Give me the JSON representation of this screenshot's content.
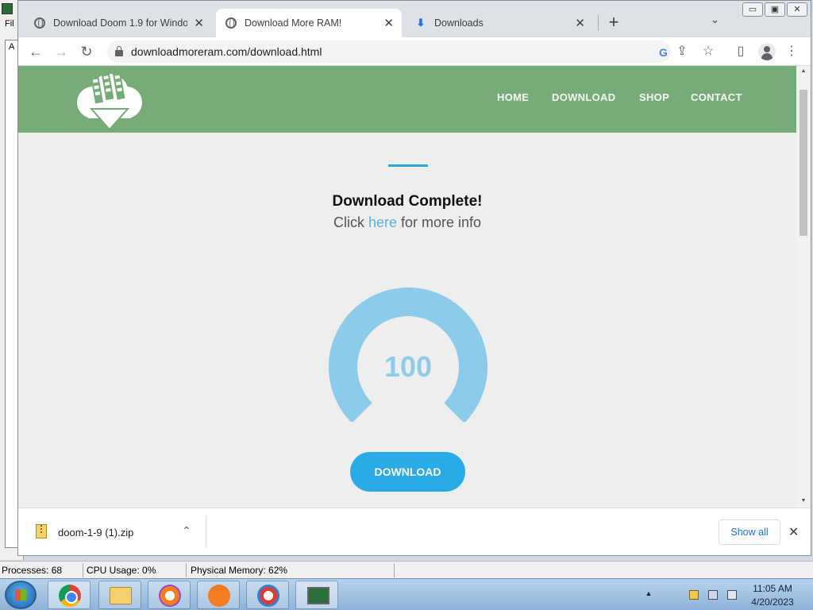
{
  "background_app": {
    "menu_label": "Fil",
    "box_label": "A"
  },
  "browser": {
    "tabs": [
      {
        "title": "Download Doom 1.9 for Window",
        "active": false
      },
      {
        "title": "Download More RAM!",
        "active": true
      },
      {
        "title": "Downloads",
        "active": false
      }
    ],
    "tab_close_glyph": "✕",
    "new_tab_glyph": "+",
    "tab_search_glyph": "⌄",
    "window_controls": [
      "▭",
      "▣",
      "✕"
    ],
    "nav": {
      "back": "←",
      "forward": "→",
      "reload": "↻"
    },
    "url": "downloadmoreram.com/download.html",
    "icons": {
      "google": "G",
      "share": "⇪",
      "bookmark": "☆",
      "sidebar": "▯",
      "menu": "⋮"
    }
  },
  "site": {
    "nav_links": [
      "HOME",
      "DOWNLOAD",
      "SHOP",
      "CONTACT"
    ],
    "heading": "Download",
    "complete_text": "Download Complete!",
    "info": {
      "prefix": "Click ",
      "link": "here",
      "suffix": " for more info"
    },
    "gauge": {
      "value": "100",
      "fraction": 1.0,
      "color": "#8ccbe9"
    },
    "download_button": "DOWNLOAD",
    "colors": {
      "header": "#77ac78",
      "accent": "#2aa7dc",
      "button": "#29abe7"
    }
  },
  "download_shelf": {
    "file_name": "doom-1-9 (1).zip",
    "caret": "⌃",
    "show_all": "Show all",
    "close": "✕"
  },
  "status_bar": {
    "processes": "Processes: 68",
    "cpu": "CPU Usage: 0%",
    "memory": "Physical Memory: 62%"
  },
  "taskbar": {
    "time": "11:05 AM",
    "date": "4/20/2023",
    "tray_caret": "▲"
  }
}
